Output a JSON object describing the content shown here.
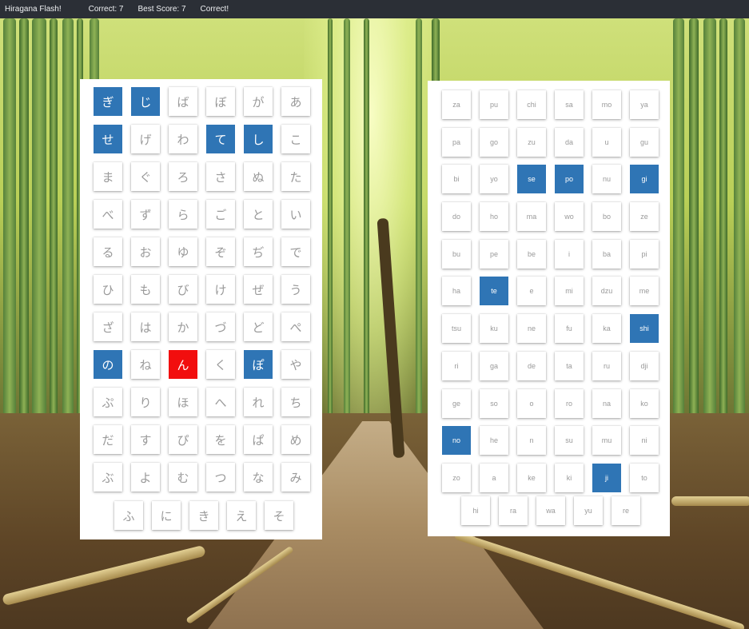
{
  "header": {
    "title": "Hiragana Flash!",
    "correct": "Correct: 7",
    "best_score": "Best Score: 7",
    "message": "Correct!"
  },
  "colors": {
    "selected": "#2f75b5",
    "wrong": "#f20e0e",
    "topbar": "#2b2f36"
  },
  "hiragana": {
    "rows": [
      [
        {
          "t": "ぎ",
          "s": "sel"
        },
        {
          "t": "じ",
          "s": "sel"
        },
        {
          "t": "ば"
        },
        {
          "t": "ぼ"
        },
        {
          "t": "が"
        },
        {
          "t": "あ"
        }
      ],
      [
        {
          "t": "せ",
          "s": "sel"
        },
        {
          "t": "げ"
        },
        {
          "t": "わ"
        },
        {
          "t": "て",
          "s": "sel"
        },
        {
          "t": "し",
          "s": "sel"
        },
        {
          "t": "こ"
        }
      ],
      [
        {
          "t": "ま"
        },
        {
          "t": "ぐ"
        },
        {
          "t": "ろ"
        },
        {
          "t": "さ"
        },
        {
          "t": "ぬ"
        },
        {
          "t": "た"
        }
      ],
      [
        {
          "t": "べ"
        },
        {
          "t": "ず"
        },
        {
          "t": "ら"
        },
        {
          "t": "ご"
        },
        {
          "t": "と"
        },
        {
          "t": "い"
        }
      ],
      [
        {
          "t": "る"
        },
        {
          "t": "お"
        },
        {
          "t": "ゆ"
        },
        {
          "t": "ぞ"
        },
        {
          "t": "ぢ"
        },
        {
          "t": "で"
        }
      ],
      [
        {
          "t": "ひ"
        },
        {
          "t": "も"
        },
        {
          "t": "び"
        },
        {
          "t": "け"
        },
        {
          "t": "ぜ"
        },
        {
          "t": "う"
        }
      ],
      [
        {
          "t": "ざ"
        },
        {
          "t": "は"
        },
        {
          "t": "か"
        },
        {
          "t": "づ"
        },
        {
          "t": "ど"
        },
        {
          "t": "ぺ"
        }
      ],
      [
        {
          "t": "の",
          "s": "sel"
        },
        {
          "t": "ね"
        },
        {
          "t": "ん",
          "s": "wrong"
        },
        {
          "t": "く"
        },
        {
          "t": "ぽ",
          "s": "sel"
        },
        {
          "t": "や"
        }
      ],
      [
        {
          "t": "ぷ"
        },
        {
          "t": "り"
        },
        {
          "t": "ほ"
        },
        {
          "t": "へ"
        },
        {
          "t": "れ"
        },
        {
          "t": "ち"
        }
      ],
      [
        {
          "t": "だ"
        },
        {
          "t": "す"
        },
        {
          "t": "ぴ"
        },
        {
          "t": "を"
        },
        {
          "t": "ぱ"
        },
        {
          "t": "め"
        }
      ],
      [
        {
          "t": "ぶ"
        },
        {
          "t": "よ"
        },
        {
          "t": "む"
        },
        {
          "t": "つ"
        },
        {
          "t": "な"
        },
        {
          "t": "み"
        }
      ]
    ],
    "last_row": [
      {
        "t": "ふ"
      },
      {
        "t": "に"
      },
      {
        "t": "き"
      },
      {
        "t": "え"
      },
      {
        "t": "そ"
      }
    ]
  },
  "romaji": {
    "rows": [
      [
        {
          "t": "za"
        },
        {
          "t": "pu"
        },
        {
          "t": "chi"
        },
        {
          "t": "sa"
        },
        {
          "t": "mo"
        },
        {
          "t": "ya"
        }
      ],
      [
        {
          "t": "pa"
        },
        {
          "t": "go"
        },
        {
          "t": "zu"
        },
        {
          "t": "da"
        },
        {
          "t": "u"
        },
        {
          "t": "gu"
        }
      ],
      [
        {
          "t": "bi"
        },
        {
          "t": "yo"
        },
        {
          "t": "se",
          "s": "sel"
        },
        {
          "t": "po",
          "s": "sel"
        },
        {
          "t": "nu"
        },
        {
          "t": "gi",
          "s": "sel"
        }
      ],
      [
        {
          "t": "do"
        },
        {
          "t": "ho"
        },
        {
          "t": "ma"
        },
        {
          "t": "wo"
        },
        {
          "t": "bo"
        },
        {
          "t": "ze"
        }
      ],
      [
        {
          "t": "bu"
        },
        {
          "t": "pe"
        },
        {
          "t": "be"
        },
        {
          "t": "i"
        },
        {
          "t": "ba"
        },
        {
          "t": "pi"
        }
      ],
      [
        {
          "t": "ha"
        },
        {
          "t": "te",
          "s": "sel"
        },
        {
          "t": "e"
        },
        {
          "t": "mi"
        },
        {
          "t": "dzu"
        },
        {
          "t": "me"
        }
      ],
      [
        {
          "t": "tsu"
        },
        {
          "t": "ku"
        },
        {
          "t": "ne"
        },
        {
          "t": "fu"
        },
        {
          "t": "ka"
        },
        {
          "t": "shi",
          "s": "sel"
        }
      ],
      [
        {
          "t": "ri"
        },
        {
          "t": "ga"
        },
        {
          "t": "de"
        },
        {
          "t": "ta"
        },
        {
          "t": "ru"
        },
        {
          "t": "dji"
        }
      ],
      [
        {
          "t": "ge"
        },
        {
          "t": "so"
        },
        {
          "t": "o"
        },
        {
          "t": "ro"
        },
        {
          "t": "na"
        },
        {
          "t": "ko"
        }
      ],
      [
        {
          "t": "no",
          "s": "sel"
        },
        {
          "t": "he"
        },
        {
          "t": "n"
        },
        {
          "t": "su"
        },
        {
          "t": "mu"
        },
        {
          "t": "ni"
        }
      ],
      [
        {
          "t": "zo"
        },
        {
          "t": "a"
        },
        {
          "t": "ke"
        },
        {
          "t": "ki"
        },
        {
          "t": "ji",
          "s": "sel"
        },
        {
          "t": "to"
        }
      ]
    ],
    "last_row": [
      {
        "t": "hi"
      },
      {
        "t": "ra"
      },
      {
        "t": "wa"
      },
      {
        "t": "yu"
      },
      {
        "t": "re"
      }
    ]
  }
}
